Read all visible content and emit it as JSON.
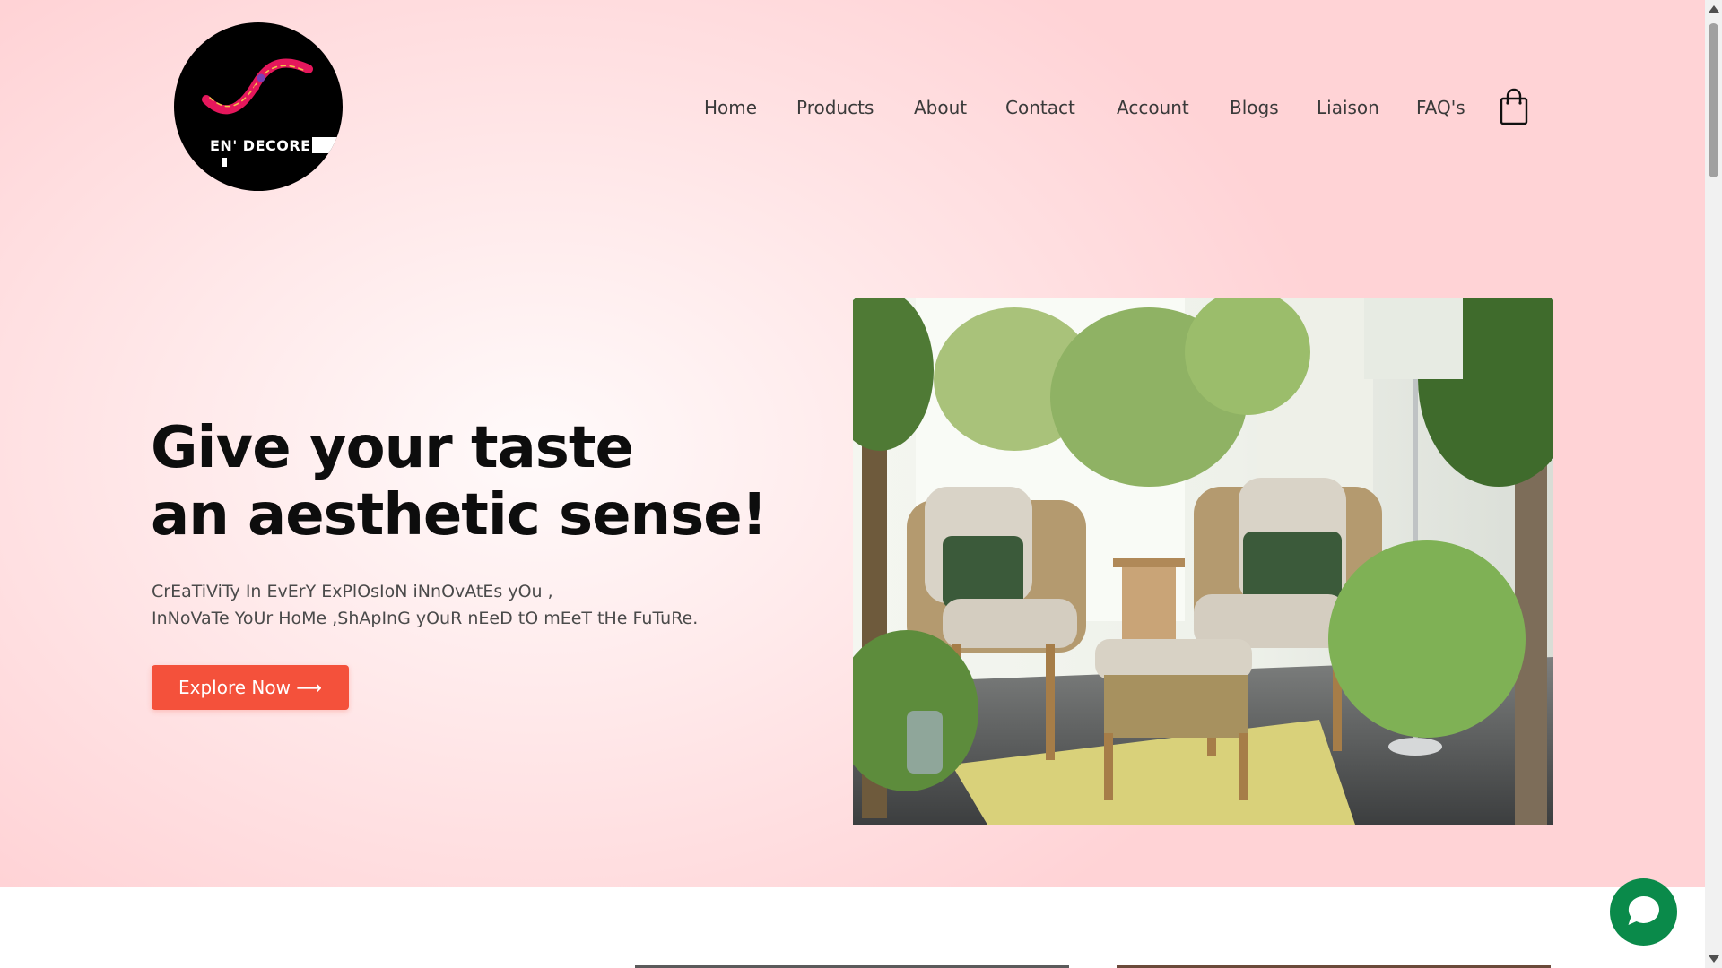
{
  "brand": {
    "logo_text": "EN' DECORE",
    "colors": {
      "primary": "#f4513b",
      "logo_bg": "#000000",
      "logo_accent": "#e5175c",
      "chat": "#0a8a4a"
    }
  },
  "nav": {
    "items": [
      {
        "label": "Home"
      },
      {
        "label": "Products"
      },
      {
        "label": "About"
      },
      {
        "label": "Contact"
      },
      {
        "label": "Account"
      },
      {
        "label": "Blogs"
      },
      {
        "label": "Liaison"
      },
      {
        "label": "FAQ's"
      }
    ],
    "cart_icon": "shopping-bag-icon"
  },
  "hero": {
    "headline_line1": "Give your taste",
    "headline_line2": "an aesthetic sense!",
    "subtext_line1": "CrEaTiViTy In EvErY ExPlOsIoN iNnOvAtEs yOu ,",
    "subtext_line2": "InNoVaTe YoUr HoMe ,ShApInG yOuR nEeD tO mEeT tHe FuTuRe.",
    "cta_label": "Explore Now ⟶"
  },
  "widgets": {
    "chat_icon": "chat-bubble-icon"
  }
}
